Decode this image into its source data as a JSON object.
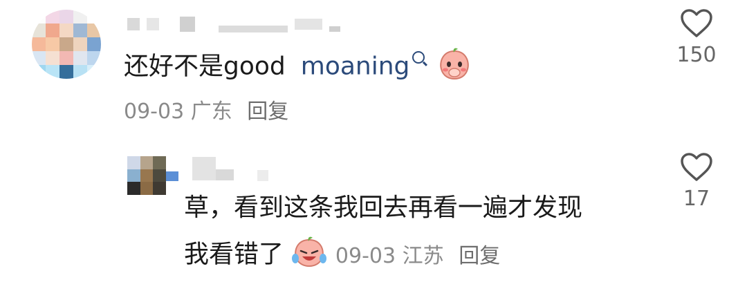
{
  "comments": [
    {
      "text_main": "还好不是good",
      "text_link": "moaning",
      "date": "09-03",
      "location": "广东",
      "reply_label": "回复",
      "like_count": "150",
      "emoji": "shy-peach-emoji"
    },
    {
      "text_line1": "草，看到这条我回去再看一遍才发现",
      "text_line2": "我看错了",
      "date": "09-03",
      "location": "江苏",
      "reply_label": "回复",
      "like_count": "17",
      "emoji": "crying-laughing-peach-emoji"
    }
  ],
  "colors": {
    "text": "#1a1a1a",
    "meta": "#8a8a8a",
    "link": "#2b4a7a",
    "icon": "#555555"
  },
  "icons": {
    "like": "heart-outline-icon",
    "search": "search-icon"
  }
}
